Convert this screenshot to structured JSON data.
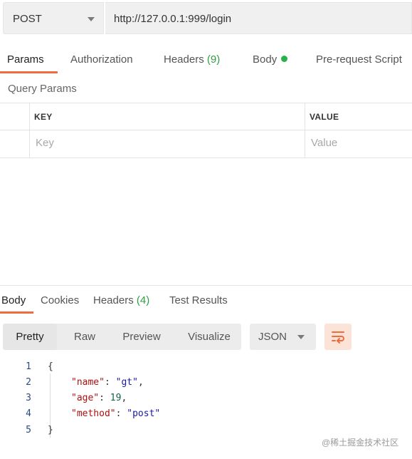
{
  "request": {
    "method": "POST",
    "url": "http://127.0.0.1:999/login"
  },
  "request_tabs": {
    "params": "Params",
    "authorization": "Authorization",
    "headers": "Headers",
    "headers_count": "(9)",
    "body": "Body",
    "prerequest": "Pre-request Script"
  },
  "query_params": {
    "title": "Query Params",
    "key_header": "KEY",
    "value_header": "VALUE",
    "key_placeholder": "Key",
    "value_placeholder": "Value"
  },
  "response_tabs": {
    "body": "Body",
    "cookies": "Cookies",
    "headers": "Headers",
    "headers_count": "(4)",
    "test_results": "Test Results"
  },
  "view_modes": {
    "pretty": "Pretty",
    "raw": "Raw",
    "preview": "Preview",
    "visualize": "Visualize",
    "format": "JSON"
  },
  "response_body": {
    "line_numbers": [
      "1",
      "2",
      "3",
      "4",
      "5"
    ],
    "open_brace": "{",
    "close_brace": "}",
    "fields": [
      {
        "key": "\"name\"",
        "value": "\"gt\"",
        "trail": ","
      },
      {
        "key": "\"age\"",
        "value": "19",
        "trail": ","
      },
      {
        "key": "\"method\"",
        "value": "\"post\"",
        "trail": ""
      }
    ]
  },
  "watermark": "@稀土掘金技术社区",
  "colors": {
    "accent": "#f26b3a",
    "status_green": "#26b14a"
  }
}
